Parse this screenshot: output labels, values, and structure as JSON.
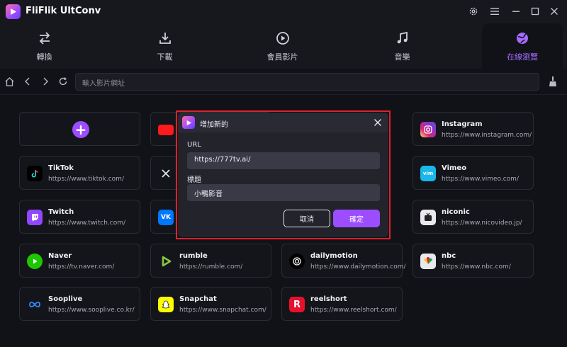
{
  "app": {
    "title": "FliFlik UltConv",
    "accent": "#9b4dff"
  },
  "titlebar": {
    "icons": [
      "gear-icon",
      "menu-icon",
      "minimize-icon",
      "maximize-icon",
      "close-icon"
    ]
  },
  "tabs": [
    {
      "label": "轉換",
      "icon": "convert-icon"
    },
    {
      "label": "下載",
      "icon": "download-icon"
    },
    {
      "label": "會員影片",
      "icon": "play-circle-icon"
    },
    {
      "label": "音樂",
      "icon": "music-icon"
    },
    {
      "label": "在線瀏覽",
      "icon": "globe-icon",
      "active": true
    }
  ],
  "toolbar": {
    "url_placeholder": "輸入影片網址"
  },
  "sites": [
    {
      "name": "Instagram",
      "url": "https://www.instagram.com/"
    },
    {
      "name": "TikTok",
      "url": "https://www.tiktok.com/"
    },
    {
      "name": "Vimeo",
      "url": "https://www.vimeo.com/"
    },
    {
      "name": "Twitch",
      "url": "https://www.twitch.com/"
    },
    {
      "name": "niconic",
      "url": "https://www.nicovideo.jp/"
    },
    {
      "name": "Naver",
      "url": "https://tv.naver.com/"
    },
    {
      "name": "rumble",
      "url": "https://rumble.com/"
    },
    {
      "name": "dailymotion",
      "url": "https://www.dailymotion.com/"
    },
    {
      "name": "nbc",
      "url": "https://www.nbc.com/"
    },
    {
      "name": "Sooplive",
      "url": "https://www.sooplive.co.kr/"
    },
    {
      "name": "Snapchat",
      "url": "https://www.snapchat.com/"
    },
    {
      "name": "reelshort",
      "url": "https://www.reelshort.com/"
    }
  ],
  "dialog": {
    "title": "增加新的",
    "url_label": "URL",
    "url_value": "https://777tv.ai/",
    "title_label": "標題",
    "title_value": "小鴨影音",
    "cancel_label": "取消",
    "confirm_label": "確定"
  }
}
